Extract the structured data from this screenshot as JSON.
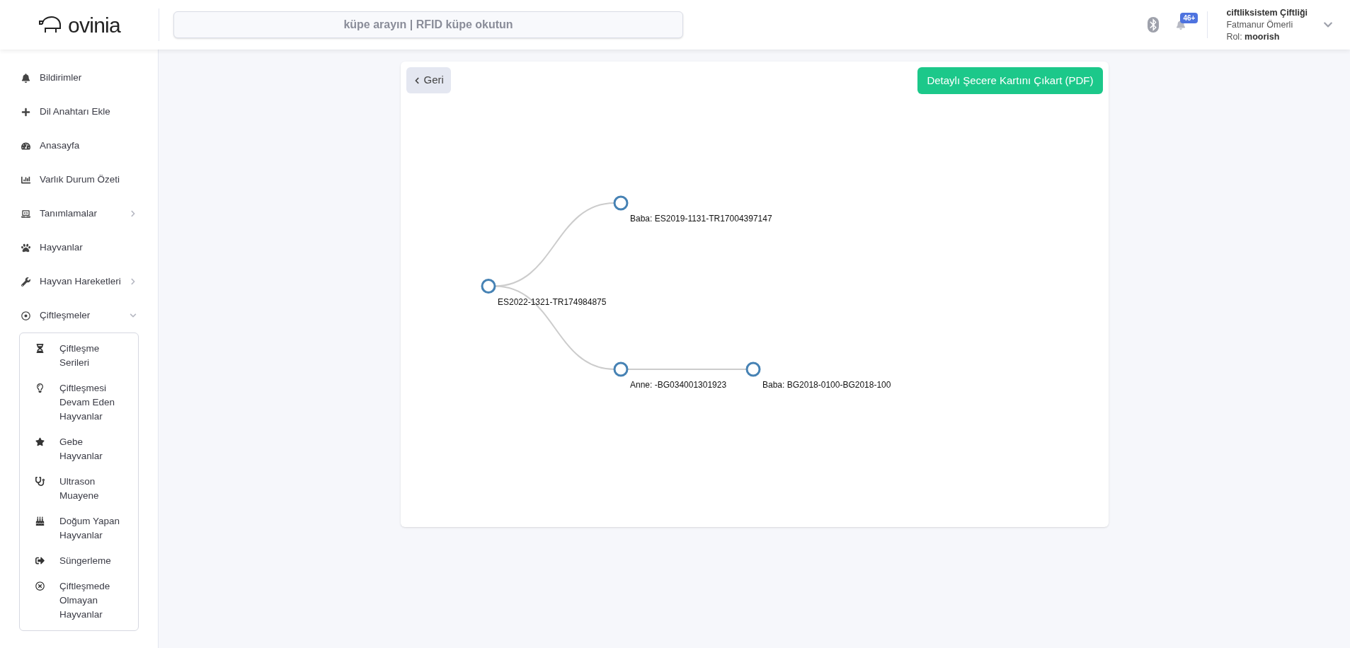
{
  "header": {
    "logo": "ovinia",
    "search": {
      "placeholder": "küpe arayın | RFID küpe okutun"
    },
    "notification_badge": "46+",
    "user": {
      "farm": "ciftliksistem Çiftliği",
      "name": "Fatmanur Ömerli",
      "role_label": "Rol:",
      "role": "moorish"
    }
  },
  "sidebar": {
    "items": [
      {
        "label": "Bildirimler",
        "kind": "link"
      },
      {
        "label": "Dil Anahtarı Ekle",
        "kind": "link"
      },
      {
        "label": "Anasayfa",
        "kind": "link"
      },
      {
        "label": "Varlık Durum Özeti",
        "kind": "link"
      },
      {
        "label": "Tanımlamalar",
        "kind": "group",
        "expanded": false
      },
      {
        "label": "Hayvanlar",
        "kind": "link"
      },
      {
        "label": "Hayvan Hareketleri",
        "kind": "group",
        "expanded": false
      },
      {
        "label": "Çiftleşmeler",
        "kind": "group",
        "expanded": true,
        "children": [
          {
            "label": "Çiftleşme Serileri"
          },
          {
            "label": "Çiftleşmesi Devam Eden Hayvanlar"
          },
          {
            "label": "Gebe Hayvanlar"
          },
          {
            "label": "Ultrason Muayene"
          },
          {
            "label": "Doğum Yapan Hayvanlar"
          },
          {
            "label": "Süngerleme"
          },
          {
            "label": "Çiftleşmede Olmayan Hayvanlar"
          }
        ]
      }
    ]
  },
  "card": {
    "back_button": "Geri",
    "pdf_button": "Detaylı Şecere Kartını Çıkart (PDF)",
    "tree": {
      "label": "ES2022-1321-TR174984875",
      "children": [
        {
          "label": "Baba: ES2019-1131-TR17004397147"
        },
        {
          "label": "Anne: -BG034001301923",
          "children": [
            {
              "label": "Baba: BG2018-0100-BG2018-100"
            }
          ]
        }
      ]
    }
  }
}
